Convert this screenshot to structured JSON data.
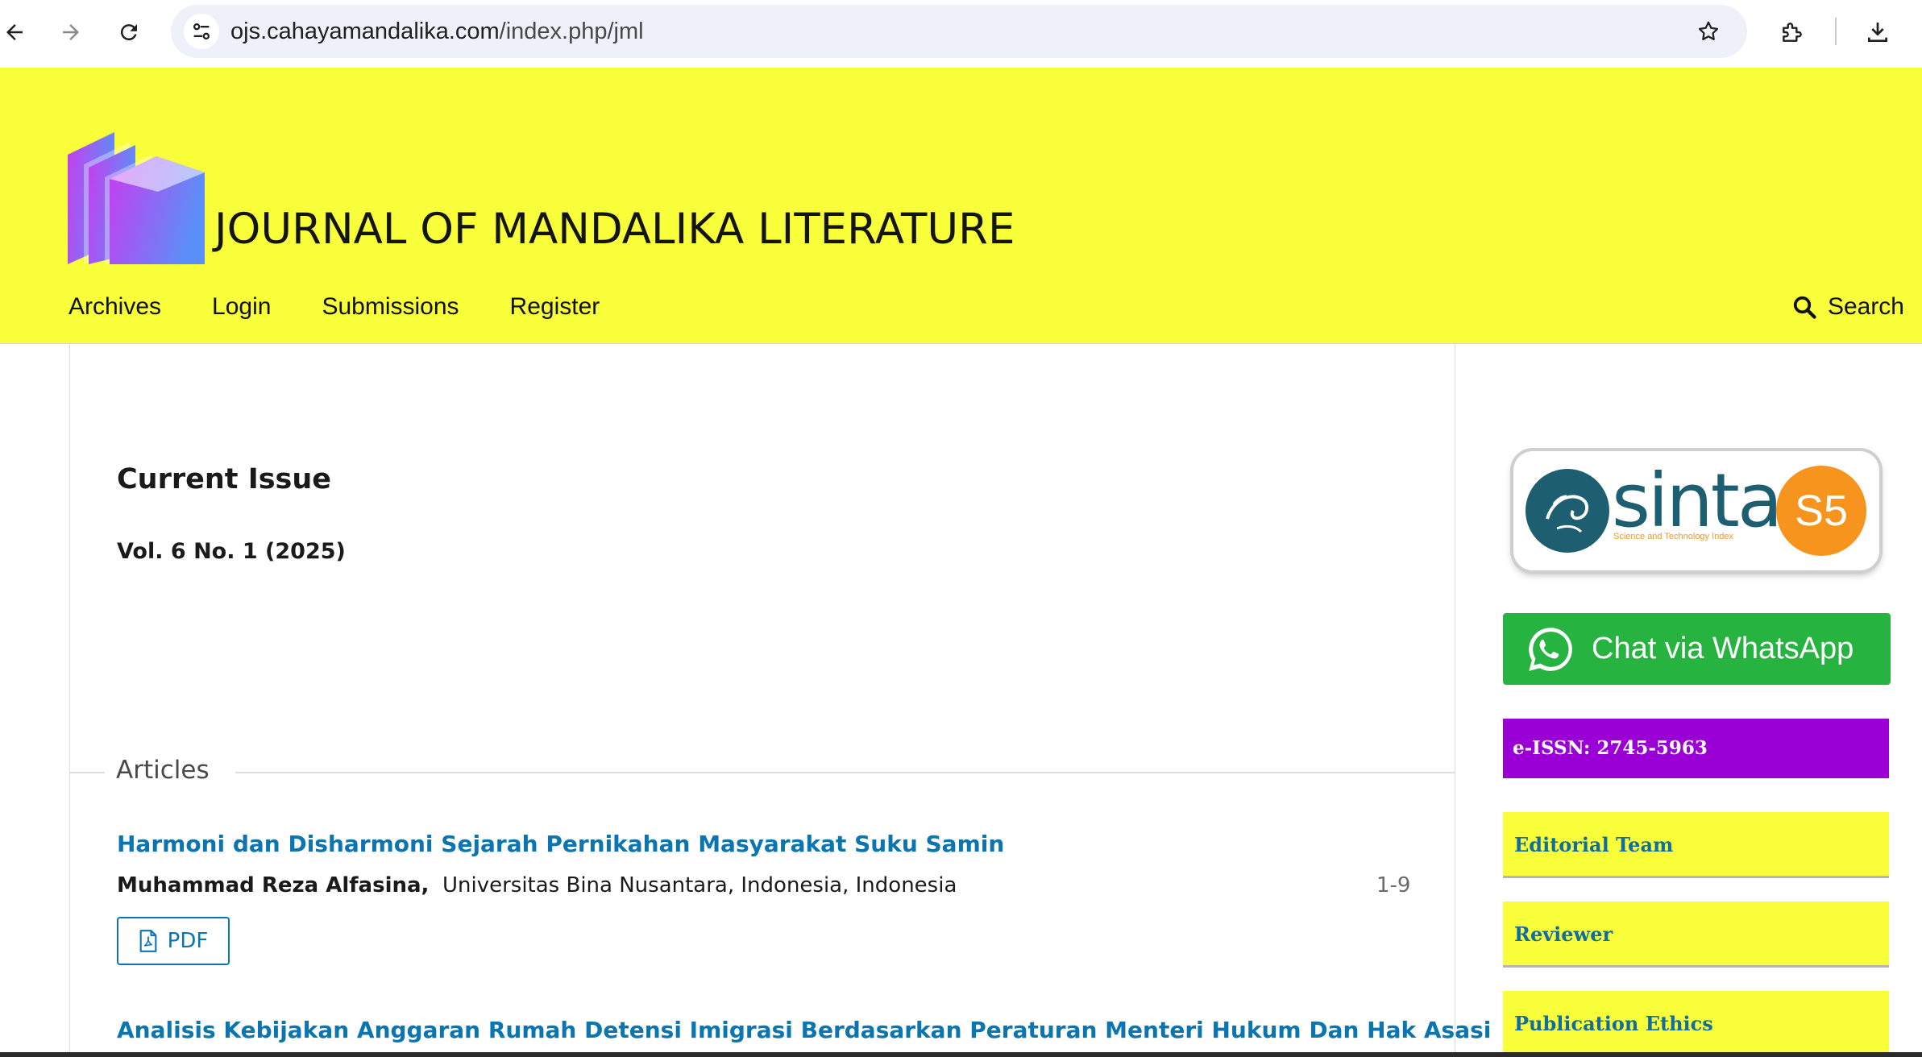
{
  "browser": {
    "url_host": "ojs.cahayamandalika.com",
    "url_path": "/index.php/jml"
  },
  "header": {
    "site_title": "JOURNAL OF MANDALIKA LITERATURE",
    "nav": [
      "Archives",
      "Login",
      "Submissions",
      "Register"
    ],
    "search_label": "Search",
    "background": "#f8fe3a"
  },
  "main": {
    "page_title": "Current Issue",
    "issue": "Vol. 6 No. 1 (2025)",
    "section_title": "Articles",
    "articles": [
      {
        "title": "Harmoni dan Disharmoni Sejarah Pernikahan Masyarakat Suku Samin",
        "author": "Muhammad Reza Alfasina,",
        "affiliation": "Universitas Bina Nusantara, Indonesia,  Indonesia",
        "pages": "1-9",
        "galley": "PDF"
      },
      {
        "title": "Analisis Kebijakan Anggaran Rumah Detensi Imigrasi Berdasarkan Peraturan Menteri Hukum Dan Hak Asasi"
      }
    ],
    "link_color": "#0a75b0"
  },
  "sidebar": {
    "sinta": {
      "brand": "sinta",
      "tagline": "Science and Technology Index",
      "rank": "S5"
    },
    "whatsapp_label": "Chat via WhatsApp",
    "issn": "e-ISSN: 2745-5963",
    "links": [
      "Editorial Team",
      "Reviewer",
      "Publication Ethics"
    ],
    "whatsapp_color": "#27b340",
    "issn_color": "#9a00d6"
  }
}
